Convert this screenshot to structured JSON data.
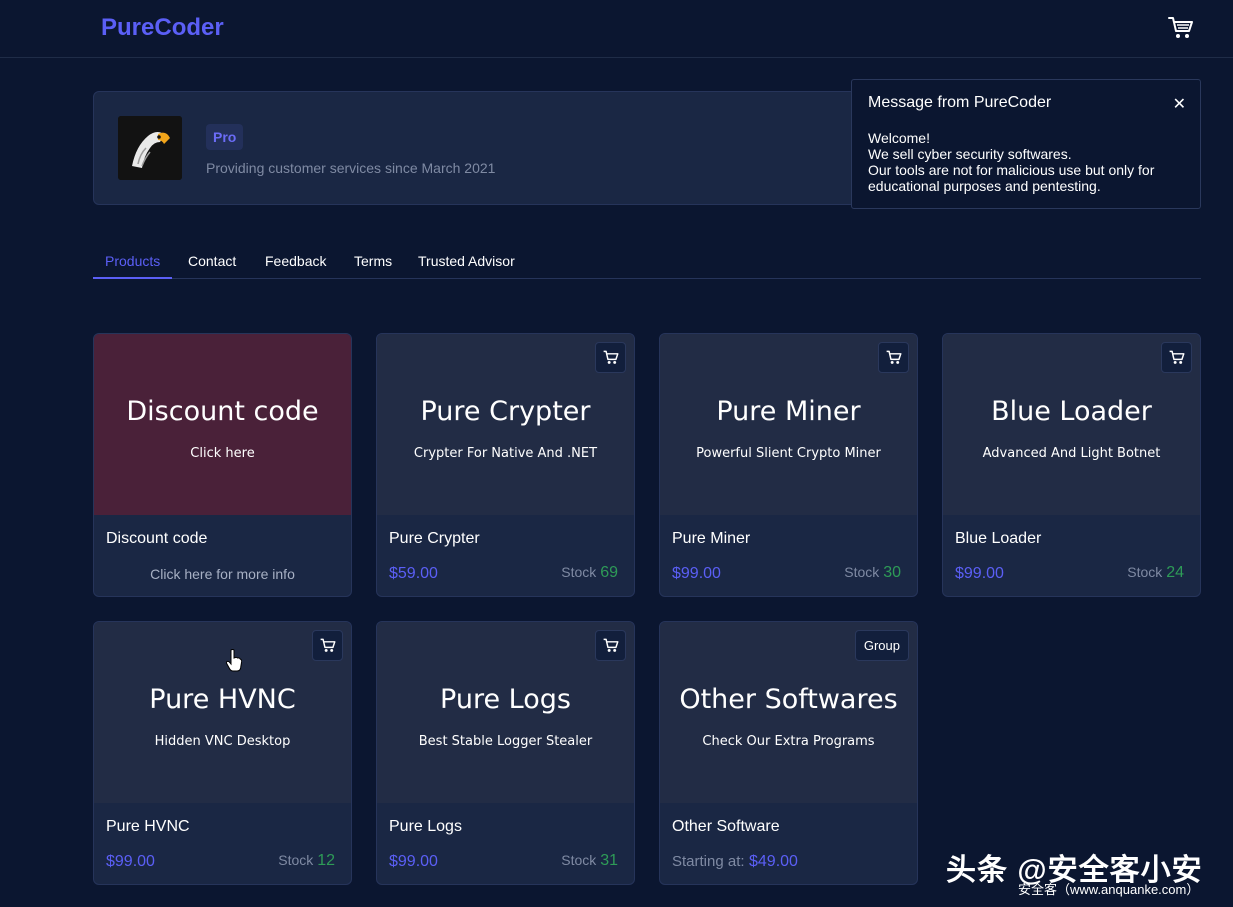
{
  "header": {
    "logo": "PureCoder",
    "cart_icon": "cart-icon"
  },
  "profile": {
    "badge": "Pro",
    "since": "Providing customer services since March 2021"
  },
  "toast": {
    "title": "Message from PureCoder",
    "close": "✕",
    "line1": "Welcome!",
    "line2": "We sell cyber security softwares.",
    "line3": "Our tools are not for malicious use but only for educational purposes and pentesting."
  },
  "tabs": [
    {
      "label": "Products",
      "active": true
    },
    {
      "label": "Contact"
    },
    {
      "label": "Feedback"
    },
    {
      "label": "Terms"
    },
    {
      "label": "Trusted Advisor"
    }
  ],
  "cards": [
    {
      "hero_title": "Discount code",
      "hero_sub": "Click here",
      "name": "Discount code",
      "info": "Click here for more info"
    },
    {
      "hero_title": "Pure Crypter",
      "hero_sub": "Crypter For Native And .NET",
      "name": "Pure Crypter",
      "price": "$59.00",
      "stock_label": "Stock",
      "stock": "69"
    },
    {
      "hero_title": "Pure Miner",
      "hero_sub": "Powerful Slient Crypto Miner",
      "name": "Pure Miner",
      "price": "$99.00",
      "stock_label": "Stock",
      "stock": "30"
    },
    {
      "hero_title": "Blue Loader",
      "hero_sub": "Advanced And Light Botnet",
      "name": "Blue Loader",
      "price": "$99.00",
      "stock_label": "Stock",
      "stock": "24"
    },
    {
      "hero_title": "Pure HVNC",
      "hero_sub": "Hidden VNC Desktop",
      "name": "Pure HVNC",
      "price": "$99.00",
      "stock_label": "Stock",
      "stock": "12"
    },
    {
      "hero_title": "Pure Logs",
      "hero_sub": "Best Stable Logger Stealer",
      "name": "Pure Logs",
      "price": "$99.00",
      "stock_label": "Stock",
      "stock": "31"
    },
    {
      "hero_title": "Other Softwares",
      "hero_sub": "Check Our Extra Programs",
      "name": "Other Software",
      "group_label": "Group",
      "starting_label": "Starting at:",
      "price": "$49.00"
    }
  ],
  "watermark": {
    "main": "头条 @安全客小安",
    "sub": "安全客（www.anquanke.com）"
  },
  "colors": {
    "background": "#0b1630",
    "accent": "#5b5ff6",
    "stock_green": "#2e9b57",
    "discount_hero": "#4a2139"
  }
}
